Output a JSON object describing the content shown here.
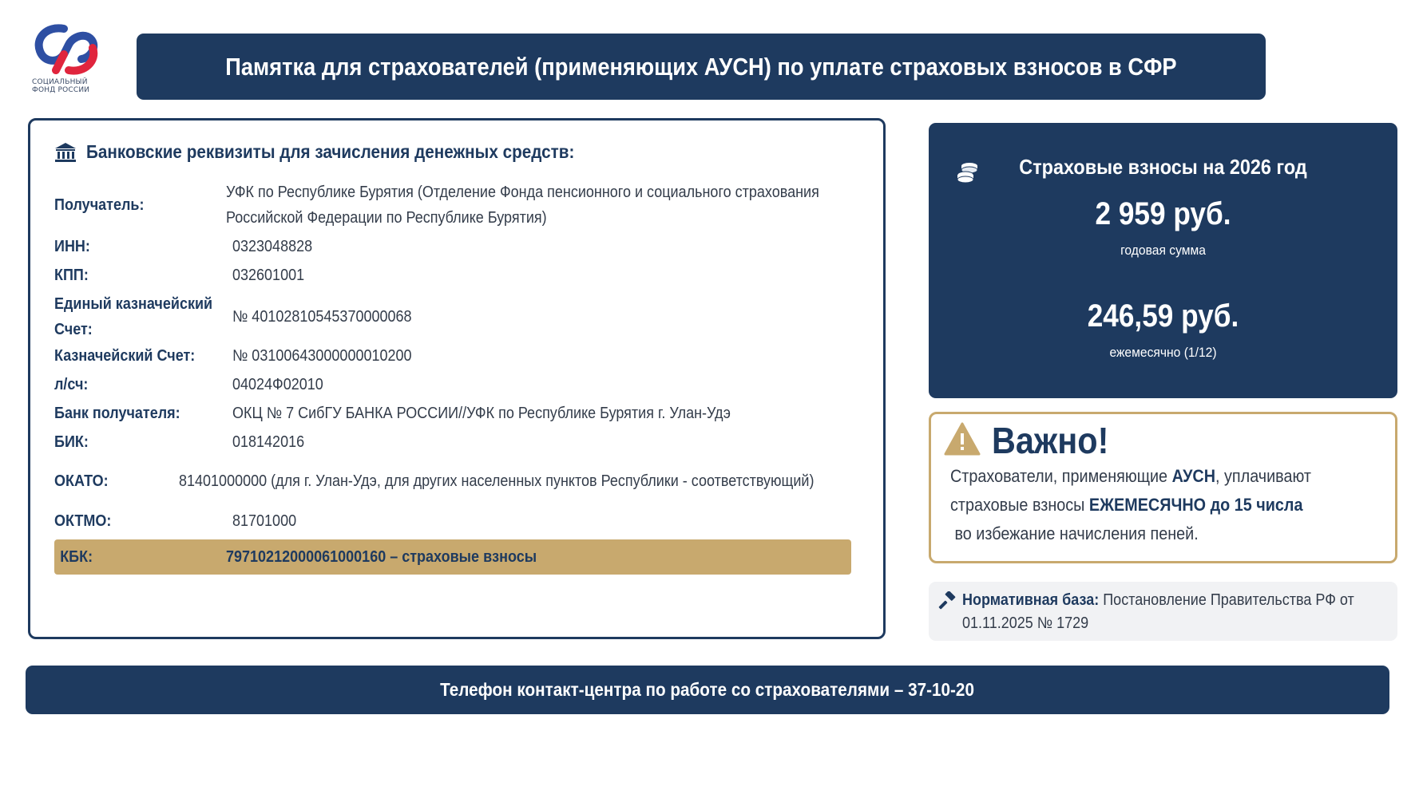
{
  "logo": {
    "line1": "СОЦИАЛЬНЫЙ",
    "line2": "ФОНД РОССИИ",
    "colors": {
      "blue": "#2e4fa3",
      "red": "#e0253d"
    }
  },
  "title": "Памятка для страхователей (применяющих АУСН) по уплате страховых взносов в СФР",
  "requisites": {
    "heading": "Банковские реквизиты для зачисления денежных средств:",
    "icon": "bank-icon",
    "rows": {
      "recipient": {
        "label": "Получатель:",
        "value_line1": "УФК по Республике Бурятия (Отделение Фонда пенсионного и социального страхования",
        "value_line2": "Российской Федерации по Республике Бурятия)"
      },
      "inn": {
        "label": "ИНН:",
        "value": "0323048828"
      },
      "kpp": {
        "label": "КПП:",
        "value": "032601001"
      },
      "treasury_single": {
        "label_line1": "Единый казначейский",
        "label_line2": "Счет:",
        "value": "№ 40102810545370000068"
      },
      "treasury": {
        "label": "Казначейский Счет:",
        "value": "№ 03100643000000010200"
      },
      "ls": {
        "label": "л/сч:",
        "value": "04024Ф02010"
      },
      "bank": {
        "label": "Банк получателя:",
        "value": "ОКЦ № 7 СибГУ БАНКА РОССИИ//УФК по Республике Бурятия г. Улан-Удэ"
      },
      "bik": {
        "label": "БИК:",
        "value": "018142016"
      },
      "okato": {
        "label": "ОКАТО:",
        "value": "81401000000 (для г. Улан-Удэ, для других населенных пунктов Республики - соответствующий)"
      },
      "oktmo": {
        "label": "ОКТМО:",
        "value": "81701000"
      },
      "kbk": {
        "label": "КБК:",
        "value": "79710212000061000160 – страховые взносы"
      }
    }
  },
  "contributions": {
    "icon": "coins-icon",
    "title": "Страховые взносы на 2026 год",
    "annual_amount": "2 959 руб.",
    "annual_caption": "годовая сумма",
    "monthly_amount": "246,59 руб.",
    "monthly_caption": "ежемесячно (1/12)"
  },
  "important": {
    "icon": "warning-icon",
    "title": "Важно!",
    "line1_pre": "Страхователи, применяющие ",
    "line1_bold": "АУСН",
    "line1_post": ", уплачивают",
    "line2_pre": "страховые взносы ",
    "line2_bold": "ЕЖЕМЕСЯЧНО до 15 числа",
    "line3": " во избежание начисления пеней."
  },
  "legal_basis": {
    "icon": "gavel-icon",
    "label": "Нормативная база:",
    "text_line1": " Постановление Правительства РФ от",
    "text_line2": "01.11.2025 № 1729"
  },
  "footer": "Телефон контакт-центра по работе со страхователями – 37-10-20",
  "colors": {
    "navy": "#1e3a5f",
    "gold": "#c8a96e",
    "light_gray": "#f1f2f4"
  }
}
